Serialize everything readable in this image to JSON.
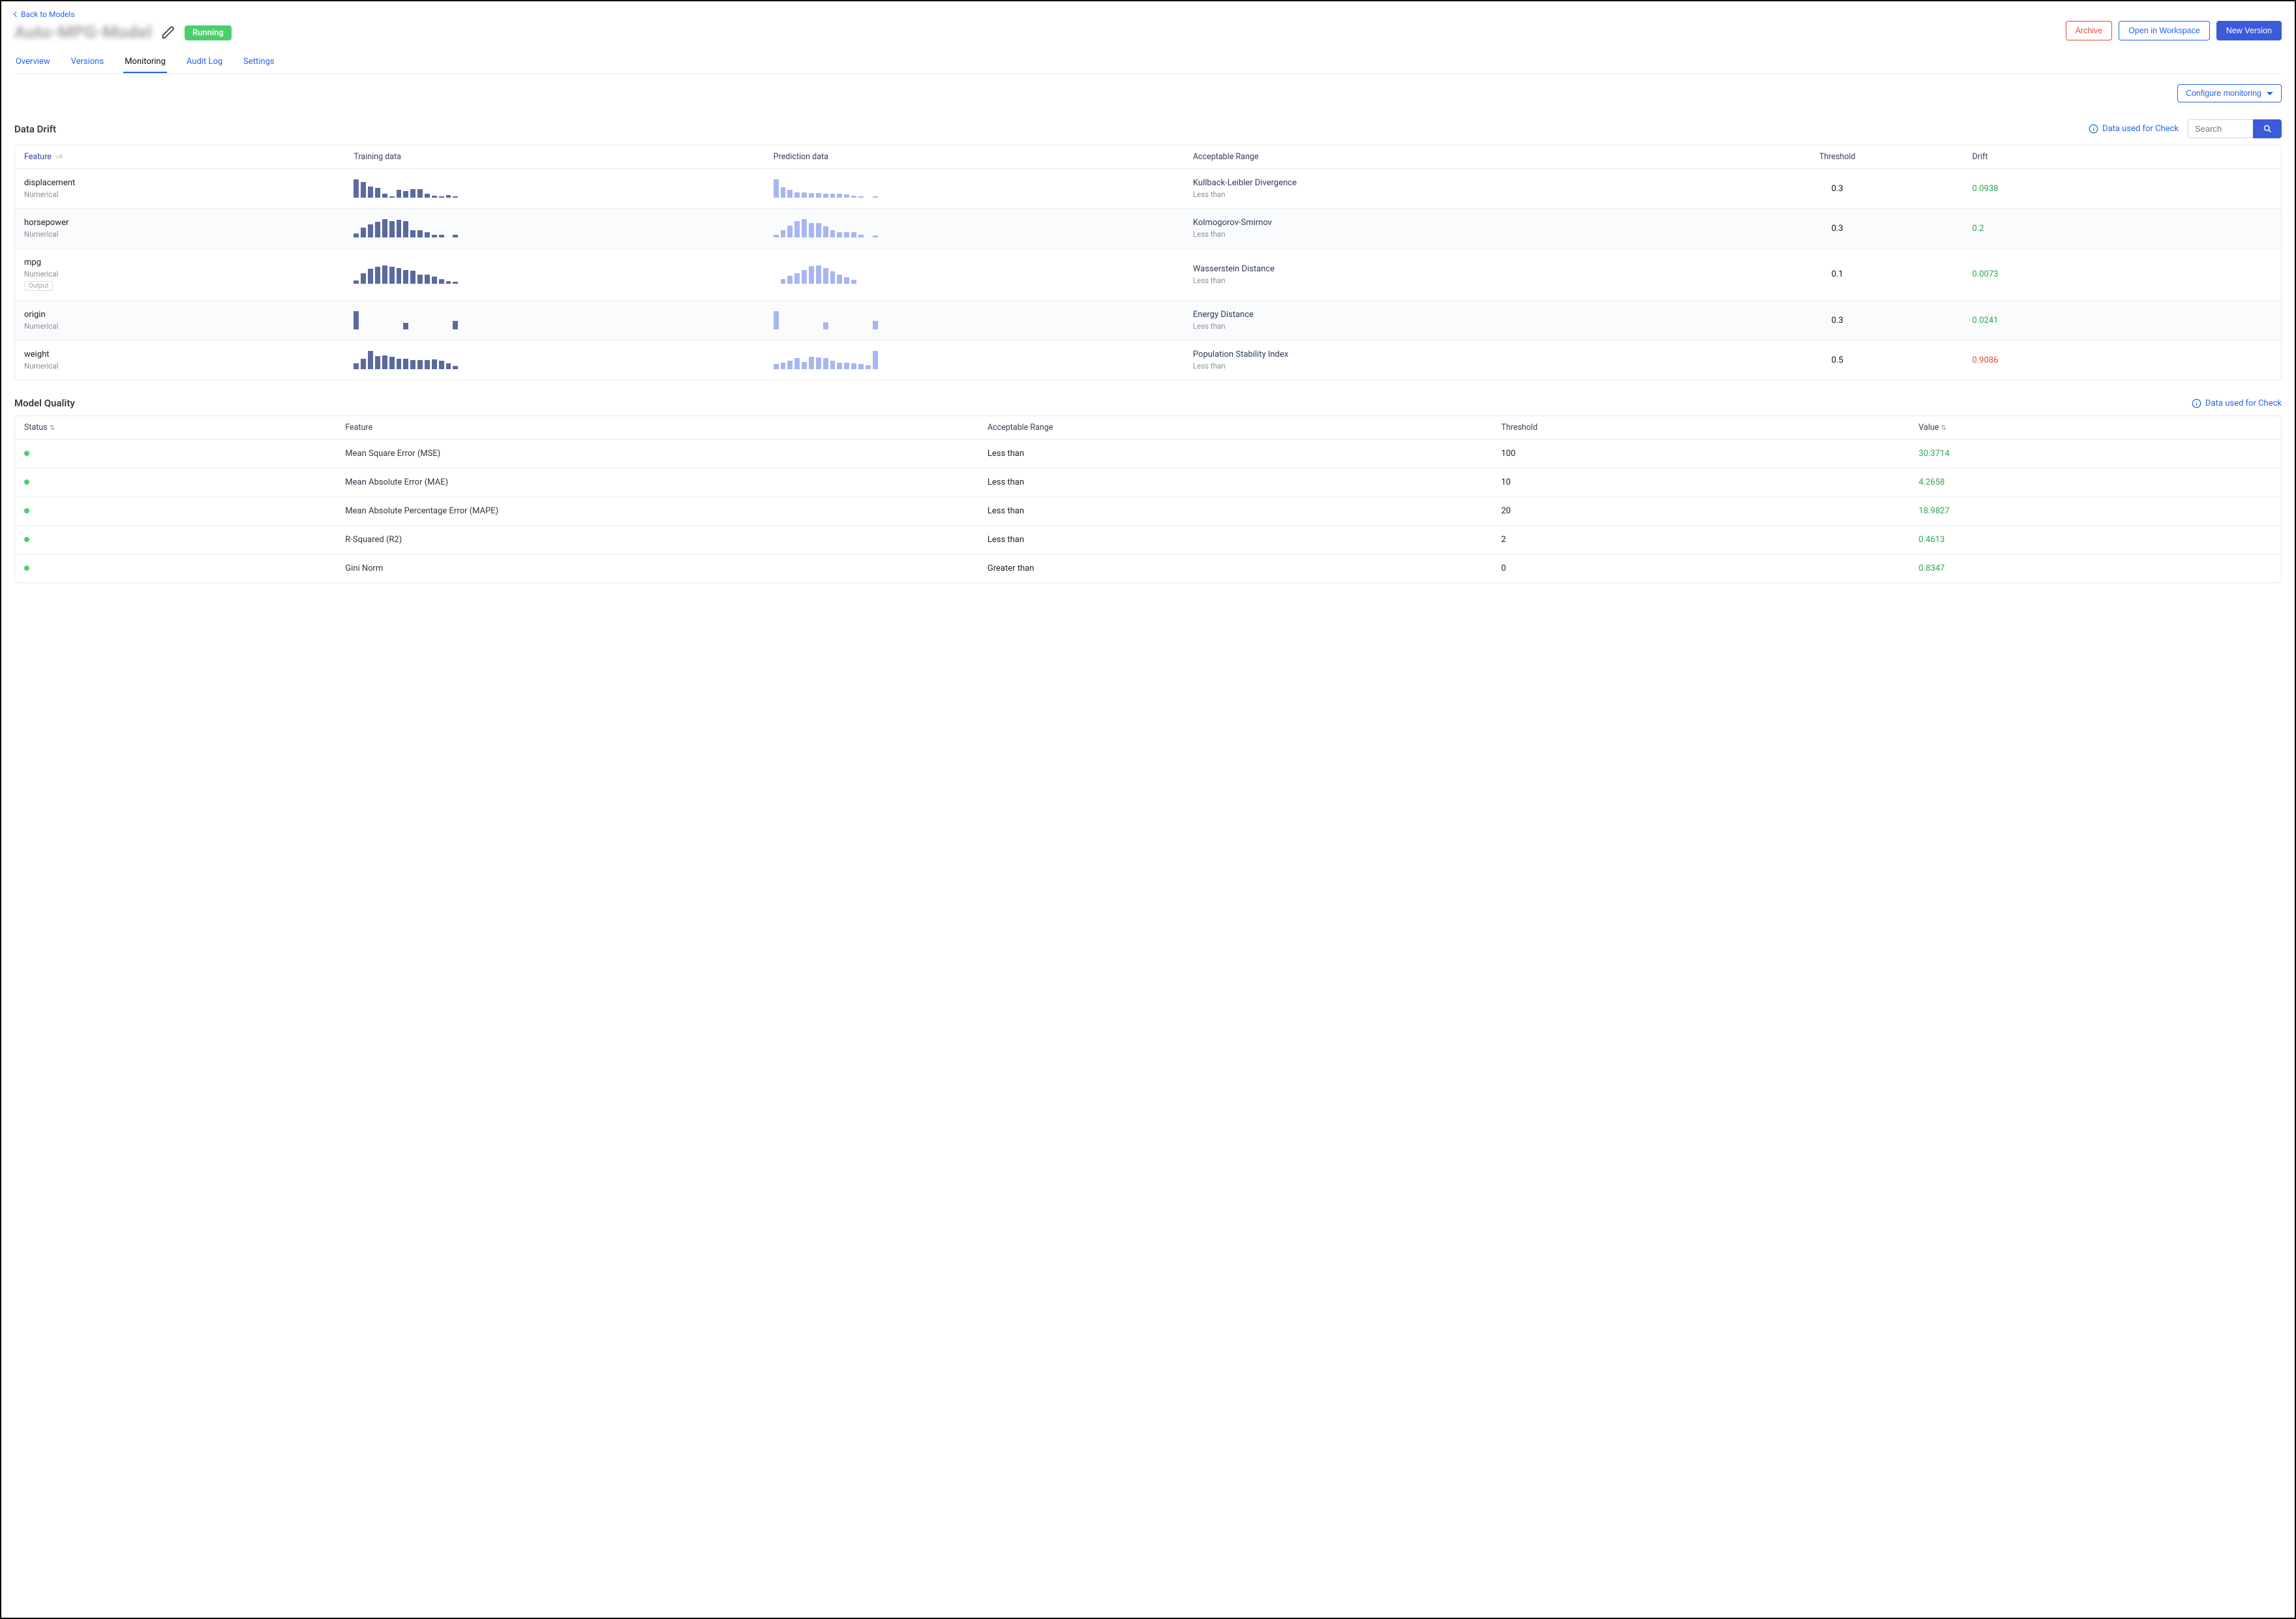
{
  "nav": {
    "back": "Back to Models",
    "title": "Auto-MPG-Model",
    "status": "Running"
  },
  "buttons": {
    "archive": "Archive",
    "workspace": "Open in Workspace",
    "newVersion": "New Version",
    "configure": "Configure monitoring"
  },
  "tabs": [
    "Overview",
    "Versions",
    "Monitoring",
    "Audit Log",
    "Settings"
  ],
  "activeTab": "Monitoring",
  "drift": {
    "title": "Data Drift",
    "infoLink": "Data used for Check",
    "searchPlaceholder": "Search",
    "columns": [
      "Feature",
      "Training data",
      "Prediction data",
      "Acceptable Range",
      "Threshold",
      "Drift"
    ],
    "rows": [
      {
        "feature": "displacement",
        "type": "Numerical",
        "output": false,
        "range": "Kullback-Leibler Divergence",
        "rangeSub": "Less than",
        "threshold": "0.3",
        "drift": "0.0938",
        "status": "ok",
        "train": [
          26,
          22,
          16,
          14,
          6,
          2,
          11,
          9,
          12,
          12,
          6,
          3,
          2,
          4,
          2
        ],
        "pred": [
          24,
          14,
          10,
          7,
          7,
          6,
          6,
          5,
          5,
          5,
          4,
          3,
          2,
          0,
          2
        ]
      },
      {
        "feature": "horsepower",
        "type": "Numerical",
        "output": false,
        "range": "Kolmogorov-Smirnov",
        "rangeSub": "Less than",
        "threshold": "0.3",
        "drift": "0.2",
        "status": "ok",
        "train": [
          4,
          11,
          14,
          17,
          20,
          18,
          19,
          18,
          8,
          8,
          6,
          3,
          3,
          0,
          3
        ],
        "pred": [
          3,
          8,
          13,
          18,
          20,
          16,
          16,
          12,
          8,
          6,
          6,
          6,
          3,
          0,
          2
        ]
      },
      {
        "feature": "mpg",
        "type": "Numerical",
        "output": true,
        "range": "Wasserstein Distance",
        "rangeSub": "Less than",
        "threshold": "0.1",
        "drift": "0.0073",
        "status": "ok",
        "train": [
          4,
          13,
          19,
          22,
          24,
          22,
          20,
          18,
          17,
          12,
          12,
          9,
          6,
          3,
          2
        ],
        "pred": [
          0,
          5,
          8,
          11,
          15,
          19,
          20,
          17,
          13,
          10,
          7,
          4,
          0,
          0,
          0
        ]
      },
      {
        "feature": "origin",
        "type": "Numerical",
        "output": false,
        "range": "Energy Distance",
        "rangeSub": "Less than",
        "threshold": "0.3",
        "drift": "0.0241",
        "status": "ok",
        "train": [
          24,
          0,
          0,
          0,
          0,
          0,
          0,
          9,
          0,
          0,
          0,
          0,
          0,
          0,
          11
        ],
        "pred": [
          22,
          0,
          0,
          0,
          0,
          0,
          0,
          9,
          0,
          0,
          0,
          0,
          0,
          0,
          10
        ]
      },
      {
        "feature": "weight",
        "type": "Numerical",
        "output": false,
        "range": "Population Stability Index",
        "rangeSub": "Less than",
        "threshold": "0.5",
        "drift": "0.9086",
        "status": "bad",
        "train": [
          8,
          14,
          24,
          17,
          18,
          16,
          14,
          14,
          12,
          12,
          12,
          13,
          11,
          8,
          4
        ],
        "pred": [
          6,
          8,
          10,
          13,
          9,
          15,
          14,
          13,
          10,
          8,
          8,
          7,
          6,
          5,
          22
        ]
      }
    ]
  },
  "quality": {
    "title": "Model Quality",
    "infoLink": "Data used for Check",
    "columns": [
      "Status",
      "Feature",
      "Acceptable Range",
      "Threshold",
      "Value"
    ],
    "rows": [
      {
        "feature": "Mean Square Error (MSE)",
        "range": "Less than",
        "threshold": "100",
        "value": "30.3714",
        "status": "ok"
      },
      {
        "feature": "Mean Absolute Error (MAE)",
        "range": "Less than",
        "threshold": "10",
        "value": "4.2658",
        "status": "ok"
      },
      {
        "feature": "Mean Absolute Percentage Error (MAPE)",
        "range": "Less than",
        "threshold": "20",
        "value": "18.9827",
        "status": "ok"
      },
      {
        "feature": "R-Squared (R2)",
        "range": "Less than",
        "threshold": "2",
        "value": "0.4613",
        "status": "ok"
      },
      {
        "feature": "Gini Norm",
        "range": "Greater than",
        "threshold": "0",
        "value": "0.8347",
        "status": "ok"
      }
    ]
  },
  "chart_data": [
    {
      "type": "bar",
      "title": "displacement — training",
      "categories": [
        "b1",
        "b2",
        "b3",
        "b4",
        "b5",
        "b6",
        "b7",
        "b8",
        "b9",
        "b10",
        "b11",
        "b12",
        "b13",
        "b14",
        "b15"
      ],
      "values": [
        26,
        22,
        16,
        14,
        6,
        2,
        11,
        9,
        12,
        12,
        6,
        3,
        2,
        4,
        2
      ]
    },
    {
      "type": "bar",
      "title": "displacement — prediction",
      "categories": [
        "b1",
        "b2",
        "b3",
        "b4",
        "b5",
        "b6",
        "b7",
        "b8",
        "b9",
        "b10",
        "b11",
        "b12",
        "b13",
        "b14",
        "b15"
      ],
      "values": [
        24,
        14,
        10,
        7,
        7,
        6,
        6,
        5,
        5,
        5,
        4,
        3,
        2,
        0,
        2
      ]
    },
    {
      "type": "bar",
      "title": "horsepower — training",
      "categories": [
        "b1",
        "b2",
        "b3",
        "b4",
        "b5",
        "b6",
        "b7",
        "b8",
        "b9",
        "b10",
        "b11",
        "b12",
        "b13",
        "b14",
        "b15"
      ],
      "values": [
        4,
        11,
        14,
        17,
        20,
        18,
        19,
        18,
        8,
        8,
        6,
        3,
        3,
        0,
        3
      ]
    },
    {
      "type": "bar",
      "title": "horsepower — prediction",
      "categories": [
        "b1",
        "b2",
        "b3",
        "b4",
        "b5",
        "b6",
        "b7",
        "b8",
        "b9",
        "b10",
        "b11",
        "b12",
        "b13",
        "b14",
        "b15"
      ],
      "values": [
        3,
        8,
        13,
        18,
        20,
        16,
        16,
        12,
        8,
        6,
        6,
        6,
        3,
        0,
        2
      ]
    },
    {
      "type": "bar",
      "title": "mpg — training",
      "categories": [
        "b1",
        "b2",
        "b3",
        "b4",
        "b5",
        "b6",
        "b7",
        "b8",
        "b9",
        "b10",
        "b11",
        "b12",
        "b13",
        "b14",
        "b15"
      ],
      "values": [
        4,
        13,
        19,
        22,
        24,
        22,
        20,
        18,
        17,
        12,
        12,
        9,
        6,
        3,
        2
      ]
    },
    {
      "type": "bar",
      "title": "mpg — prediction",
      "categories": [
        "b1",
        "b2",
        "b3",
        "b4",
        "b5",
        "b6",
        "b7",
        "b8",
        "b9",
        "b10",
        "b11",
        "b12",
        "b13",
        "b14",
        "b15"
      ],
      "values": [
        0,
        5,
        8,
        11,
        15,
        19,
        20,
        17,
        13,
        10,
        7,
        4,
        0,
        0,
        0
      ]
    },
    {
      "type": "bar",
      "title": "origin — training",
      "categories": [
        "b1",
        "b2",
        "b3",
        "b4",
        "b5",
        "b6",
        "b7",
        "b8",
        "b9",
        "b10",
        "b11",
        "b12",
        "b13",
        "b14",
        "b15"
      ],
      "values": [
        24,
        0,
        0,
        0,
        0,
        0,
        0,
        9,
        0,
        0,
        0,
        0,
        0,
        0,
        11
      ]
    },
    {
      "type": "bar",
      "title": "origin — prediction",
      "categories": [
        "b1",
        "b2",
        "b3",
        "b4",
        "b5",
        "b6",
        "b7",
        "b8",
        "b9",
        "b10",
        "b11",
        "b12",
        "b13",
        "b14",
        "b15"
      ],
      "values": [
        22,
        0,
        0,
        0,
        0,
        0,
        0,
        9,
        0,
        0,
        0,
        0,
        0,
        0,
        10
      ]
    },
    {
      "type": "bar",
      "title": "weight — training",
      "categories": [
        "b1",
        "b2",
        "b3",
        "b4",
        "b5",
        "b6",
        "b7",
        "b8",
        "b9",
        "b10",
        "b11",
        "b12",
        "b13",
        "b14",
        "b15"
      ],
      "values": [
        8,
        14,
        24,
        17,
        18,
        16,
        14,
        14,
        12,
        12,
        12,
        13,
        11,
        8,
        4
      ]
    },
    {
      "type": "bar",
      "title": "weight — prediction",
      "categories": [
        "b1",
        "b2",
        "b3",
        "b4",
        "b5",
        "b6",
        "b7",
        "b8",
        "b9",
        "b10",
        "b11",
        "b12",
        "b13",
        "b14",
        "b15"
      ],
      "values": [
        6,
        8,
        10,
        13,
        9,
        15,
        14,
        13,
        10,
        8,
        8,
        7,
        6,
        5,
        22
      ]
    }
  ]
}
